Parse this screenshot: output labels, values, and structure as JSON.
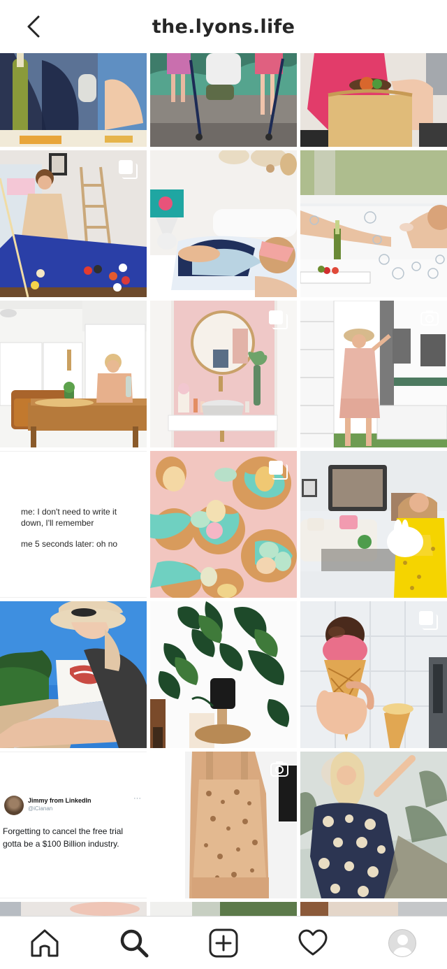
{
  "header": {
    "title": "the.lyons.life",
    "back_icon": "chevron-left-icon"
  },
  "posts": [
    {
      "id": "p1",
      "badge": "none"
    },
    {
      "id": "p2",
      "badge": "none"
    },
    {
      "id": "p3",
      "badge": "none"
    },
    {
      "id": "p4",
      "badge": "multi"
    },
    {
      "id": "p5",
      "badge": "none"
    },
    {
      "id": "p6",
      "badge": "none"
    },
    {
      "id": "p7",
      "badge": "none"
    },
    {
      "id": "p8",
      "badge": "multi"
    },
    {
      "id": "p9",
      "badge": "video"
    },
    {
      "id": "p10",
      "badge": "none"
    },
    {
      "id": "p11",
      "badge": "multi"
    },
    {
      "id": "p12",
      "badge": "none"
    },
    {
      "id": "p13",
      "badge": "none"
    },
    {
      "id": "p14",
      "badge": "none"
    },
    {
      "id": "p15",
      "badge": "multi"
    },
    {
      "id": "p16",
      "badge": "none"
    },
    {
      "id": "p17",
      "badge": "video"
    },
    {
      "id": "p18",
      "badge": "none"
    }
  ],
  "meme_post": {
    "line1": "me: I don't need to write it down, I'll remember",
    "line2": "me 5 seconds later: oh no"
  },
  "tweet_post": {
    "name": "Jimmy from LinkedIn",
    "handle": "@iCianan",
    "dots": "···",
    "body": "Forgetting to cancel the free trial gotta be a $100 Billion industry."
  },
  "bottom_nav": {
    "items": [
      "home-icon",
      "search-icon",
      "add-post-icon",
      "heart-icon",
      "profile-avatar"
    ],
    "active": "search-icon"
  },
  "colors": {
    "text": "#262626",
    "divider": "#dbdbdb",
    "background": "#ffffff"
  }
}
